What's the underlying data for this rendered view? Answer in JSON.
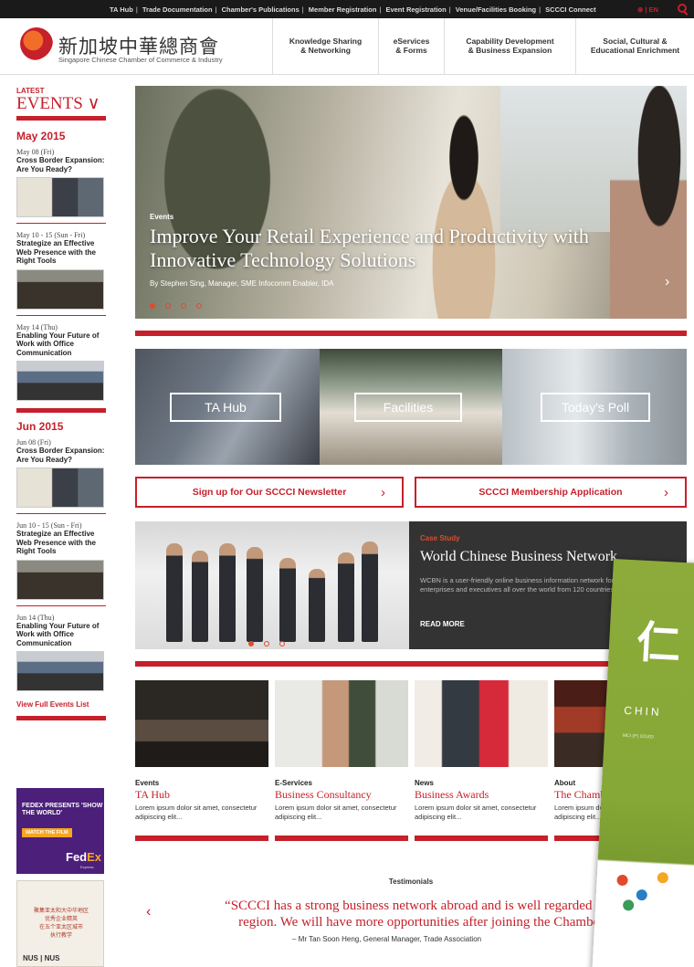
{
  "topbar": {
    "links": [
      "TA Hub",
      "Trade Documentation",
      "Chamber's Publications",
      "Member Registration",
      "Event Registration",
      "Venue/Facilities Booking",
      "SCCCI Connect"
    ],
    "lang": "| EN",
    "colors": {
      "accent": "#c6202b",
      "bar": "#1a1a1a"
    }
  },
  "header": {
    "logo_cn": "新加坡中華總商會",
    "logo_en": "Singapore Chinese Chamber of Commerce & Industry",
    "nav": [
      "Knowledge Sharing\n& Networking",
      "eServices\n& Forms",
      "Capability Development\n& Business Expansion",
      "Social, Cultural &\nEducational Enrichment"
    ]
  },
  "sidebar": {
    "latest": "LATEST",
    "events_heading": "EVENTS ∨",
    "months": [
      {
        "label": "May 2015",
        "events": [
          {
            "date": "May 08 (Fri)",
            "title": "Cross Border Expansion: Are You Ready?"
          },
          {
            "date": "May 10 - 15 (Sun - Fri)",
            "title": "Strategize an Effective Web Presence with the Right Tools"
          },
          {
            "date": "May 14 (Thu)",
            "title": "Enabling Your Future of Work with Office Communication"
          }
        ]
      },
      {
        "label": "Jun 2015",
        "events": [
          {
            "date": "Jun 08 (Fri)",
            "title": "Cross Border Expansion: Are You Ready?"
          },
          {
            "date": "Jun 10 - 15 (Sun - Fri)",
            "title": "Strategize an Effective Web Presence with the Right Tools"
          },
          {
            "date": "Jun 14 (Thu)",
            "title": "Enabling Your Future of Work with Office Communication"
          }
        ]
      }
    ],
    "view_all": "View Full Events List",
    "ad_fedex": {
      "title": "FEDEX PRESENTS 'SHOW THE WORLD'",
      "button": "WATCH THE FILM",
      "brand_a": "Fed",
      "brand_b": "Ex",
      "brand_sub": "Express"
    },
    "ad_nus": {
      "cn": "聚集亚太和大中华地区\n优秀企业精英\n在五个亚太区城市\n执行教学",
      "logo": "NUS | NUS"
    }
  },
  "hero": {
    "category": "Events",
    "title": "Improve Your Retail Experience and Productivity with Innovative Technology Solutions",
    "byline": "By Stephen Sing, Manager, SME Infocomm Enabler, IDA",
    "slides": 4,
    "active_slide": 1,
    "next_icon": "›"
  },
  "tiles": [
    {
      "label": "TA Hub"
    },
    {
      "label": "Facilities"
    },
    {
      "label": "Today's Poll"
    }
  ],
  "cta": {
    "newsletter": "Sign up for Our SCCCI Newsletter",
    "membership": "SCCCI Membership Application",
    "chevron": "›"
  },
  "case_study": {
    "label": "Case Study",
    "title": "World Chinese Business Network",
    "body": "WCBN is a user-friendly online business information network for ethnic Chinese enterprises and executives all over the world from 120 countries and regions.",
    "read_more": "READ MORE",
    "slides": 3,
    "active_slide": 1
  },
  "cards": [
    {
      "category": "Events",
      "title": "TA Hub",
      "desc": "Lorem ipsum dolor sit amet, consectetur adipiscing elit..."
    },
    {
      "category": "E-Services",
      "title": "Business Consultancy",
      "desc": "Lorem ipsum dolor sit amet, consectetur adipiscing elit..."
    },
    {
      "category": "News",
      "title": "Business Awards",
      "desc": "Lorem ipsum dolor sit amet, consectetur adipiscing elit..."
    },
    {
      "category": "About",
      "title": "The Chamber",
      "desc": "Lorem ipsum dolor sit amet, consectetur adipiscing elit..."
    }
  ],
  "testimonial": {
    "heading": "Testimonials",
    "quote_line1": "“SCCCI has a strong business network abroad and is well regarded in the",
    "quote_line2": "region.  We will have more opportunities after joining the Chamber.”",
    "author": "– Mr Tan Soon Heng, General Manager, Trade Association",
    "prev_icon": "‹"
  },
  "brochure": {
    "glyph": "仁",
    "text": "CHIN",
    "mci": "MCI (P) 101/03"
  }
}
